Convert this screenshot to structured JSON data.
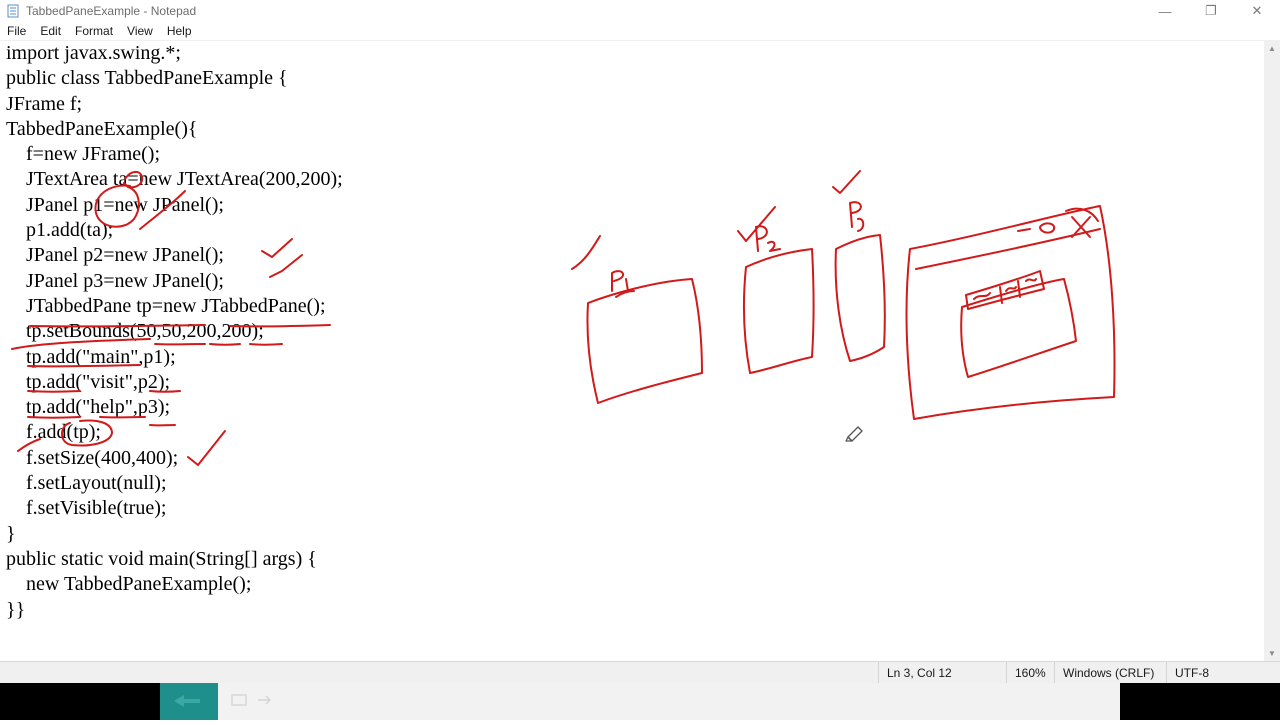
{
  "window": {
    "title": "TabbedPaneExample - Notepad",
    "controls": {
      "minimize": "—",
      "restore": "❐",
      "close": "✕"
    }
  },
  "menu": {
    "items": [
      {
        "label": "File"
      },
      {
        "label": "Edit"
      },
      {
        "label": "Format"
      },
      {
        "label": "View"
      },
      {
        "label": "Help"
      }
    ]
  },
  "editor": {
    "lines": [
      "import javax.swing.*;",
      "public class TabbedPaneExample {",
      "JFrame f;",
      "TabbedPaneExample(){",
      "    f=new JFrame();",
      "    JTextArea ta=new JTextArea(200,200);",
      "    JPanel p1=new JPanel();",
      "    p1.add(ta);",
      "    JPanel p2=new JPanel();",
      "    JPanel p3=new JPanel();",
      "    JTabbedPane tp=new JTabbedPane();",
      "    tp.setBounds(50,50,200,200);",
      "    tp.add(\"main\",p1);",
      "    tp.add(\"visit\",p2);",
      "    tp.add(\"help\",p3);",
      "    f.add(tp);",
      "    f.setSize(400,400);",
      "    f.setLayout(null);",
      "    f.setVisible(true);",
      "}",
      "public static void main(String[] args) {",
      "    new TabbedPaneExample();",
      "}}"
    ]
  },
  "status": {
    "position": "Ln 3, Col 12",
    "zoom": "160%",
    "line_ending": "Windows (CRLF)",
    "encoding": "UTF-8"
  },
  "colors": {
    "ink": "#d11a1a",
    "taskbar_active": "#1e8f8a"
  },
  "icons": {
    "app": "notepad-icon",
    "pen_cursor": "pen-cursor-icon"
  }
}
